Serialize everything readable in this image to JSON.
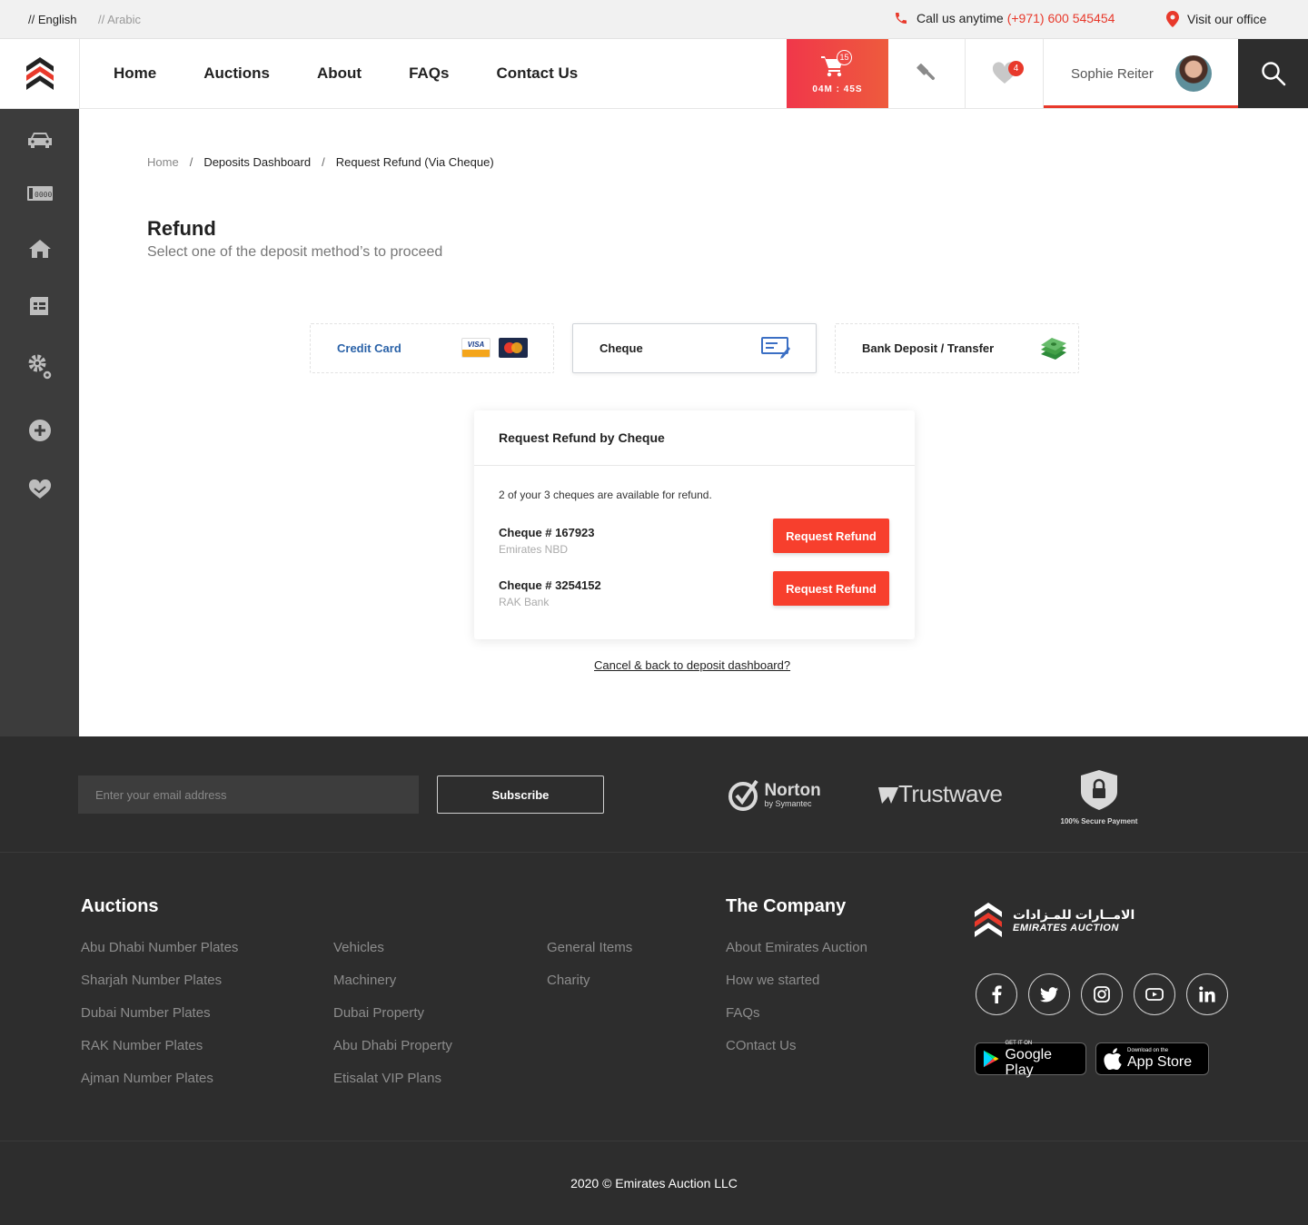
{
  "topbar": {
    "lang_en": "// English",
    "lang_ar": "// Arabic",
    "call_label": "Call us anytime",
    "call_phone": "(+971) 600 545454",
    "office_label": "Visit our office"
  },
  "nav": {
    "items": [
      "Home",
      "Auctions",
      "About",
      "FAQs",
      "Contact Us"
    ],
    "cart_count": "15",
    "cart_timer": "04M : 45S",
    "favorites_count": "4",
    "user_name": "Sophie Reiter"
  },
  "sidebar": {
    "icons": [
      "car-icon",
      "number-plate-icon",
      "property-icon",
      "general-items-icon",
      "settings-icon",
      "add-icon",
      "charity-heart-icon"
    ]
  },
  "breadcrumb": {
    "home": "Home",
    "sep": "/",
    "deposits": "Deposits Dashboard",
    "current": "Request Refund (Via Cheque)"
  },
  "page": {
    "title": "Refund",
    "subtitle": "Select one of the deposit method’s to proceed"
  },
  "methods": [
    {
      "label": "Credit Card",
      "icon": "visa-mastercard-icon",
      "selected": false
    },
    {
      "label": "Cheque",
      "icon": "cheque-icon",
      "selected": true
    },
    {
      "label": "Bank Deposit / Transfer",
      "icon": "cash-stack-icon",
      "selected": false
    }
  ],
  "refund_card": {
    "title": "Request Refund by Cheque",
    "note": "2 of your 3 cheques are available for refund.",
    "cheques": [
      {
        "number": "Cheque # 167923",
        "bank": "Emirates NBD",
        "button": "Request Refund"
      },
      {
        "number": "Cheque # 3254152",
        "bank": "RAK Bank",
        "button": "Request Refund"
      }
    ]
  },
  "cancel_link": "Cancel & back to deposit dashboard?",
  "footer": {
    "email_placeholder": "Enter your email address",
    "subscribe": "Subscribe",
    "norton_name": "Norton",
    "norton_sub": "by Symantec",
    "trustwave": "Trustwave",
    "secure_payment": "100% Secure Payment",
    "auctions_heading": "Auctions",
    "auction_col1": [
      "Abu Dhabi Number Plates",
      "Sharjah Number Plates",
      "Dubai Number Plates",
      "RAK Number Plates",
      "Ajman Number Plates"
    ],
    "auction_col2": [
      "Vehicles",
      "Machinery",
      "Dubai Property",
      "Abu Dhabi Property",
      "Etisalat VIP Plans"
    ],
    "auction_col3": [
      "General Items",
      "Charity"
    ],
    "company_heading": "The Company",
    "company_links": [
      "About Emirates Auction",
      "How we started",
      "FAQs",
      "COntact Us"
    ],
    "brand_ar": "الامــارات للمـزادات",
    "brand_en": "EMIRATES AUCTION",
    "socials": [
      "facebook-icon",
      "twitter-icon",
      "instagram-icon",
      "youtube-icon",
      "linkedin-icon"
    ],
    "google_small": "GET IT ON",
    "google_big": "Google Play",
    "apple_small": "Download on the",
    "apple_big": "App Store",
    "copyright": "2020 © Emirates Auction LLC"
  },
  "colors": {
    "accent": "#e8392b",
    "button": "#f73f2d",
    "dark": "#2d2d2d",
    "sidebar": "#3c3c3c"
  }
}
